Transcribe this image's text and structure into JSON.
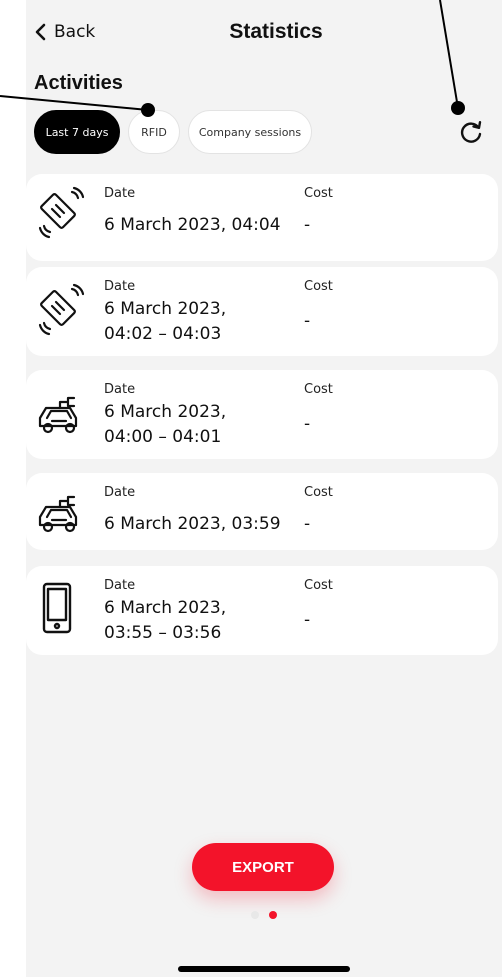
{
  "header": {
    "back_label": "Back",
    "title": "Statistics"
  },
  "section_title": "Activities",
  "filters": [
    {
      "label": "Last 7 days",
      "active": true
    },
    {
      "label": "RFID",
      "active": false
    },
    {
      "label": "Company sessions",
      "active": false
    }
  ],
  "activities": [
    {
      "icon": "rfid-card-icon",
      "date_label": "Date",
      "date_line1": "6 March 2023, 04:04",
      "date_line2": "",
      "cost_label": "Cost",
      "cost_value": "-"
    },
    {
      "icon": "rfid-card-icon",
      "date_label": "Date",
      "date_line1": "6 March 2023,",
      "date_line2": "04:02 – 04:03",
      "cost_label": "Cost",
      "cost_value": "-"
    },
    {
      "icon": "electric-car-icon",
      "date_label": "Date",
      "date_line1": "6 March 2023,",
      "date_line2": "04:00 – 04:01",
      "cost_label": "Cost",
      "cost_value": "-"
    },
    {
      "icon": "electric-car-icon",
      "date_label": "Date",
      "date_line1": "6 March 2023, 03:59",
      "date_line2": "",
      "cost_label": "Cost",
      "cost_value": "-"
    },
    {
      "icon": "smartphone-icon",
      "date_label": "Date",
      "date_line1": "6 March 2023,",
      "date_line2": "03:55 – 03:56",
      "cost_label": "Cost",
      "cost_value": "-"
    }
  ],
  "export_label": "EXPORT",
  "pager": {
    "pages": 2,
    "current": 2
  },
  "colors": {
    "accent": "#f3132a",
    "background": "#f3f3f3",
    "chip_active": "#000000"
  }
}
